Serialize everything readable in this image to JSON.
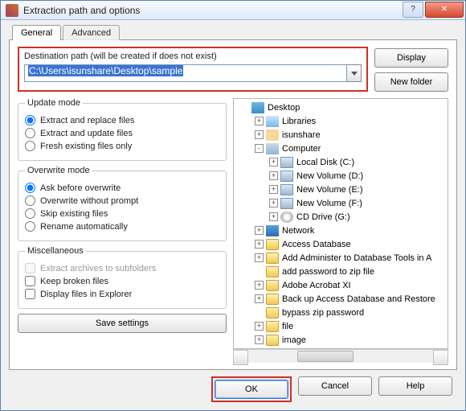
{
  "window": {
    "title": "Extraction path and options"
  },
  "tabs": {
    "general": "General",
    "advanced": "Advanced"
  },
  "dest": {
    "label": "Destination path (will be created if does not exist)",
    "value": "C:\\Users\\isunshare\\Desktop\\sample"
  },
  "buttons": {
    "display": "Display",
    "newfolder": "New folder",
    "save": "Save settings",
    "ok": "OK",
    "cancel": "Cancel",
    "help": "Help"
  },
  "update": {
    "legend": "Update mode",
    "opt1": "Extract and replace files",
    "opt2": "Extract and update files",
    "opt3": "Fresh existing files only"
  },
  "overwrite": {
    "legend": "Overwrite mode",
    "opt1": "Ask before overwrite",
    "opt2": "Overwrite without prompt",
    "opt3": "Skip existing files",
    "opt4": "Rename automatically"
  },
  "misc": {
    "legend": "Miscellaneous",
    "opt1": "Extract archives to subfolders",
    "opt2": "Keep broken files",
    "opt3": "Display files in Explorer"
  },
  "tree": [
    {
      "ind": 0,
      "tg": "",
      "icon": "desktop",
      "label": "Desktop"
    },
    {
      "ind": 1,
      "tg": "+",
      "icon": "libs",
      "label": "Libraries"
    },
    {
      "ind": 1,
      "tg": "+",
      "icon": "user",
      "label": "isunshare"
    },
    {
      "ind": 1,
      "tg": "-",
      "icon": "comp",
      "label": "Computer"
    },
    {
      "ind": 2,
      "tg": "+",
      "icon": "disk",
      "label": "Local Disk (C:)"
    },
    {
      "ind": 2,
      "tg": "+",
      "icon": "disk",
      "label": "New Volume (D:)"
    },
    {
      "ind": 2,
      "tg": "+",
      "icon": "disk",
      "label": "New Volume (E:)"
    },
    {
      "ind": 2,
      "tg": "+",
      "icon": "disk",
      "label": "New Volume (F:)"
    },
    {
      "ind": 2,
      "tg": "+",
      "icon": "cd",
      "label": "CD Drive (G:)"
    },
    {
      "ind": 1,
      "tg": "+",
      "icon": "net",
      "label": "Network"
    },
    {
      "ind": 1,
      "tg": "+",
      "icon": "folder",
      "label": "Access Database"
    },
    {
      "ind": 1,
      "tg": "+",
      "icon": "folder",
      "label": "Add Administer to Database Tools in A"
    },
    {
      "ind": 1,
      "tg": "",
      "icon": "folder",
      "label": "add password  to zip file"
    },
    {
      "ind": 1,
      "tg": "+",
      "icon": "folder",
      "label": "Adobe Acrobat XI"
    },
    {
      "ind": 1,
      "tg": "+",
      "icon": "folder",
      "label": "Back up Access Database and Restore"
    },
    {
      "ind": 1,
      "tg": "",
      "icon": "folder",
      "label": "bypass zip password"
    },
    {
      "ind": 1,
      "tg": "+",
      "icon": "folder",
      "label": "file"
    },
    {
      "ind": 1,
      "tg": "+",
      "icon": "folder",
      "label": "image"
    }
  ]
}
